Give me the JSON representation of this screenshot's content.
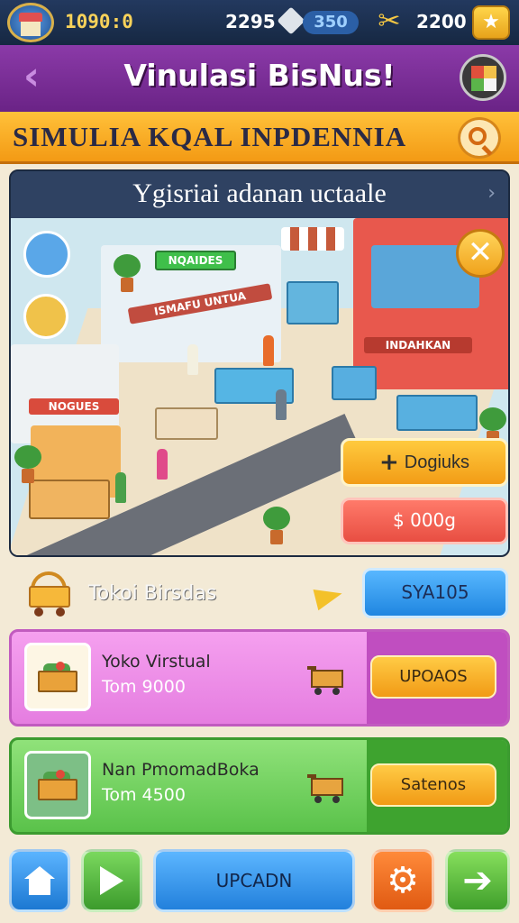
{
  "topbar": {
    "coins": "1090:0",
    "gems": "2295",
    "energy": "350",
    "xp": "2200"
  },
  "title": "Vinulasi BisNus!",
  "banner": "SIMULIA KQAL INPDENNIA",
  "scene": {
    "header": "Ygisriai adanan uctaale",
    "signs": {
      "green": "NQAIDES",
      "main": "ISMAFU UNTUA",
      "left": "NOGUES",
      "right": "INDAHKAN"
    },
    "buy_label": "Dogiuks",
    "price_label": "$ 000g"
  },
  "summary": {
    "label": "Tokoi Birsdas",
    "status_label": "SYA105"
  },
  "stores": [
    {
      "name": "Yoko Virstual",
      "cost": "Tom 9000",
      "action": "UPOAOS"
    },
    {
      "name": "Nan PmomadBoka",
      "cost": "Tom 4500",
      "action": "Satenos"
    }
  ],
  "bottom_nav": {
    "upgrade_label": "UPCADN"
  }
}
